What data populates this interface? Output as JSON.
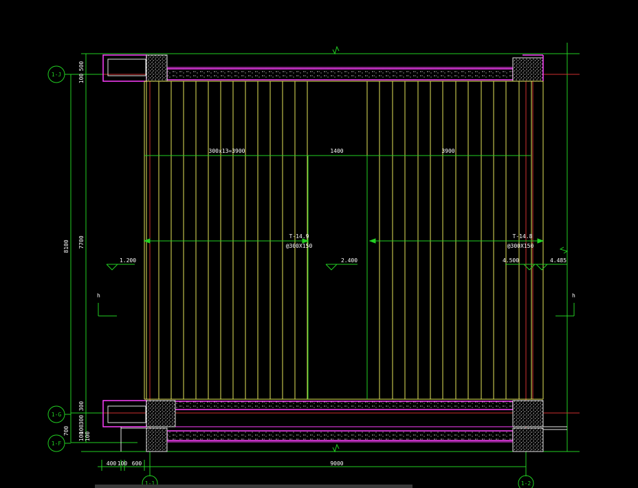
{
  "drawing": {
    "grid_labels": {
      "left": [
        "1-J",
        "1-G",
        "1-F"
      ],
      "bottom": [
        "1-1",
        "1-2"
      ]
    },
    "dimensions": {
      "left_outer": "8100",
      "left_inner": "7700",
      "left_top_a": "500",
      "left_top_b": "100",
      "left_bot_a": "300",
      "left_bot_b": "300",
      "left_bot_c": "100",
      "left_bot_d": "100",
      "left_bot_e": "100",
      "left_bot_f": "700",
      "bottom_a": "400",
      "bottom_b": "100",
      "bottom_c": "600",
      "bottom_total": "9000",
      "top_span_left": "300x13=3900",
      "top_span_mid": "1400",
      "top_span_right": "3900"
    },
    "stair_notes": {
      "left_run": "T-14.9",
      "left_spec": "@300X150",
      "right_run": "T-14.8",
      "right_spec": "@300X150"
    },
    "elevations": {
      "left": "1.200",
      "middle": "2.400",
      "right_a": "4.500",
      "right_b": "4.485"
    },
    "section_marks": {
      "left": "h",
      "right": "h"
    }
  },
  "colors": {
    "background": "#000000",
    "grid": "#22d022",
    "wall": "#ff40ff",
    "tread": "#e6e65a",
    "axis_red": "#d03030",
    "text": "#ffffff"
  }
}
